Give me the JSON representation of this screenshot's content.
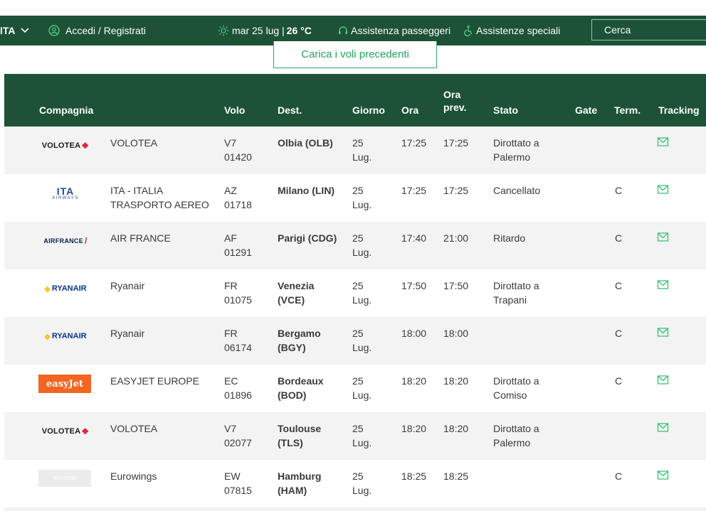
{
  "topbar": {
    "language": "ITA",
    "login": "Accedi / Registrati",
    "date_text": "mar 25 lug |",
    "temperature": "26 °C",
    "assistance": "Assistenza passeggeri",
    "special_assistance": "Assistenze speciali",
    "search": "Cerca"
  },
  "load_previous": "Carica i voli precedenti",
  "table": {
    "headers": {
      "airline": "Compagnia",
      "flight": "Volo",
      "destination": "Dest.",
      "day": "Giorno",
      "time": "Ora",
      "expected_line1": "Ora",
      "expected_line2": "prev.",
      "status": "Stato",
      "gate": "Gate",
      "terminal": "Term.",
      "tracking": "Tracking"
    },
    "rows": [
      {
        "logo": "VOLOTEA",
        "airline": "VOLOTEA",
        "flight1": "V7",
        "flight2": "01420",
        "dest1": "Olbia (OLB)",
        "dest2": "",
        "day1": "25",
        "day2": "Lug.",
        "time": "17:25",
        "expected": "17:25",
        "status1": "Dirottato a",
        "status2": "Palermo",
        "gate": "",
        "terminal": ""
      },
      {
        "logo": "ITA AIRWAYS",
        "airline": "ITA - ITALIA",
        "airline2": "TRASPORTO AEREO",
        "flight1": "AZ",
        "flight2": "01718",
        "dest1": "Milano (LIN)",
        "dest2": "",
        "day1": "25",
        "day2": "Lug.",
        "time": "17:25",
        "expected": "17:25",
        "status1": "Cancellato",
        "status2": "",
        "gate": "",
        "terminal": "C"
      },
      {
        "logo": "AIRFRANCE",
        "airline": "AIR FRANCE",
        "flight1": "AF",
        "flight2": "01291",
        "dest1": "Parigi (CDG)",
        "dest2": "",
        "day1": "25",
        "day2": "Lug.",
        "time": "17:40",
        "expected": "21:00",
        "status1": "Ritardo",
        "status2": "",
        "gate": "",
        "terminal": "C"
      },
      {
        "logo": "RYANAIR",
        "airline": "Ryanair",
        "flight1": "FR",
        "flight2": "01075",
        "dest1": "Venezia",
        "dest2": "(VCE)",
        "day1": "25",
        "day2": "Lug.",
        "time": "17:50",
        "expected": "17:50",
        "status1": "Dirottato a",
        "status2": "Trapani",
        "gate": "",
        "terminal": "C"
      },
      {
        "logo": "RYANAIR",
        "airline": "Ryanair",
        "flight1": "FR",
        "flight2": "06174",
        "dest1": "Bergamo",
        "dest2": "(BGY)",
        "day1": "25",
        "day2": "Lug.",
        "time": "18:00",
        "expected": "18:00",
        "status1": "",
        "status2": "",
        "gate": "",
        "terminal": "C"
      },
      {
        "logo": "easyJet",
        "airline": "EASYJET EUROPE",
        "flight1": "EC",
        "flight2": "01896",
        "dest1": "Bordeaux",
        "dest2": "(BOD)",
        "day1": "25",
        "day2": "Lug.",
        "time": "18:20",
        "expected": "18:20",
        "status1": "Dirottato a",
        "status2": "Comiso",
        "gate": "",
        "terminal": "C"
      },
      {
        "logo": "VOLOTEA",
        "airline": "VOLOTEA",
        "flight1": "V7",
        "flight2": "02077",
        "dest1": "Toulouse",
        "dest2": "(TLS)",
        "day1": "25",
        "day2": "Lug.",
        "time": "18:20",
        "expected": "18:20",
        "status1": "Dirottato a",
        "status2": "Palermo",
        "gate": "",
        "terminal": ""
      },
      {
        "logo": "NO LOGO",
        "airline": "Eurowings",
        "flight1": "EW",
        "flight2": "07815",
        "dest1": "Hamburg",
        "dest2": "(HAM)",
        "day1": "25",
        "day2": "Lug.",
        "time": "18:25",
        "expected": "18:25",
        "status1": "",
        "status2": "",
        "gate": "",
        "terminal": "C"
      }
    ]
  },
  "colors": {
    "header_green": "#1d5236",
    "accent_green": "#23a45c",
    "row_alt": "#f3f3f3"
  }
}
